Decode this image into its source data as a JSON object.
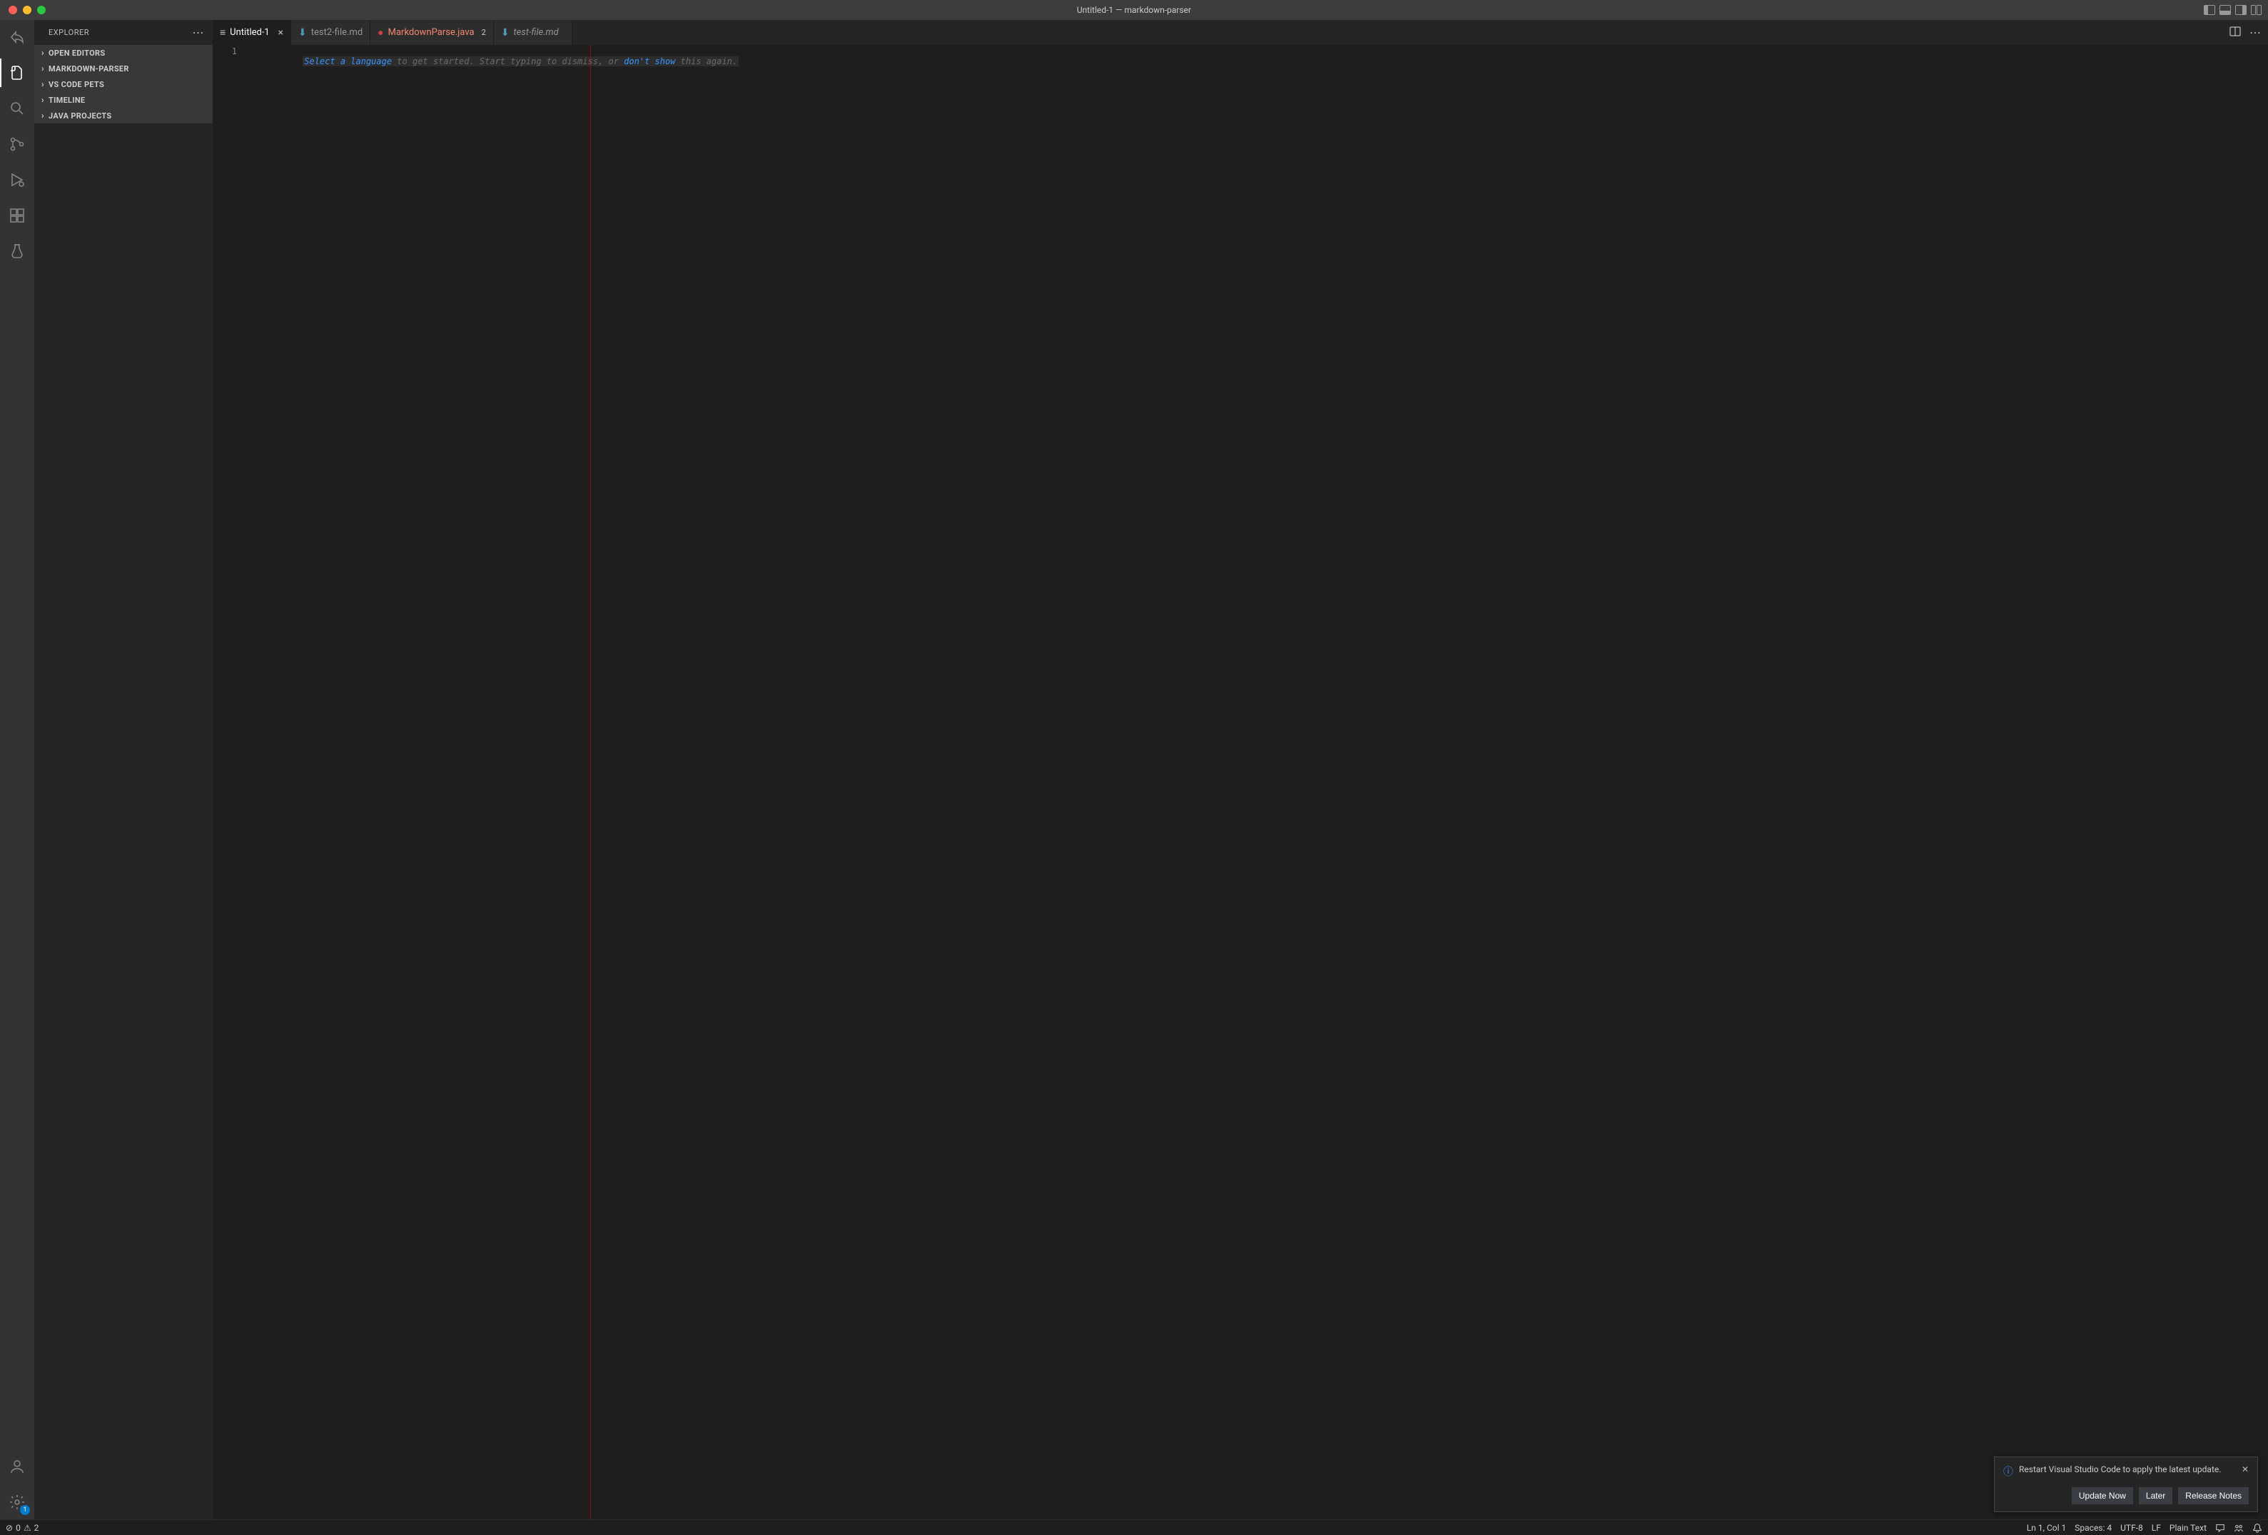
{
  "window": {
    "title": "Untitled-1 — markdown-parser"
  },
  "sidebar": {
    "title": "EXPLORER",
    "sections": [
      {
        "label": "OPEN EDITORS"
      },
      {
        "label": "MARKDOWN-PARSER"
      },
      {
        "label": "VS CODE PETS"
      },
      {
        "label": "TIMELINE"
      },
      {
        "label": "JAVA PROJECTS"
      }
    ]
  },
  "tabs": [
    {
      "label": "Untitled-1",
      "icon": "≡",
      "icon_color": "#cccccc",
      "active": true,
      "close": "×",
      "italic": false,
      "badge": ""
    },
    {
      "label": "test2-file.md",
      "icon": "⬇",
      "icon_color": "#519aba",
      "active": false,
      "close": "",
      "italic": false,
      "badge": ""
    },
    {
      "label": "MarkdownParse.java",
      "icon": "●",
      "icon_color": "#cc3e44",
      "active": false,
      "close": "",
      "italic": false,
      "badge": "2",
      "error": true
    },
    {
      "label": "test-file.md",
      "icon": "⬇",
      "icon_color": "#519aba",
      "active": false,
      "close": "",
      "italic": true,
      "badge": ""
    }
  ],
  "editor": {
    "line_number": "1",
    "hint": {
      "link1": "Select a language",
      "dim1": " to get started. Start typing to dismiss, or ",
      "link2": "don't show",
      "dim2": " this again."
    }
  },
  "notification": {
    "message": "Restart Visual Studio Code to apply the latest update.",
    "buttons": {
      "primary": "Update Now",
      "later": "Later",
      "notes": "Release Notes"
    }
  },
  "status": {
    "errors_icon": "⊘",
    "errors": "0",
    "warnings_icon": "⚠",
    "warnings": "2",
    "lncol": "Ln 1, Col 1",
    "spaces": "Spaces: 4",
    "encoding": "UTF-8",
    "eol": "LF",
    "language": "Plain Text"
  },
  "settings_badge": "1"
}
